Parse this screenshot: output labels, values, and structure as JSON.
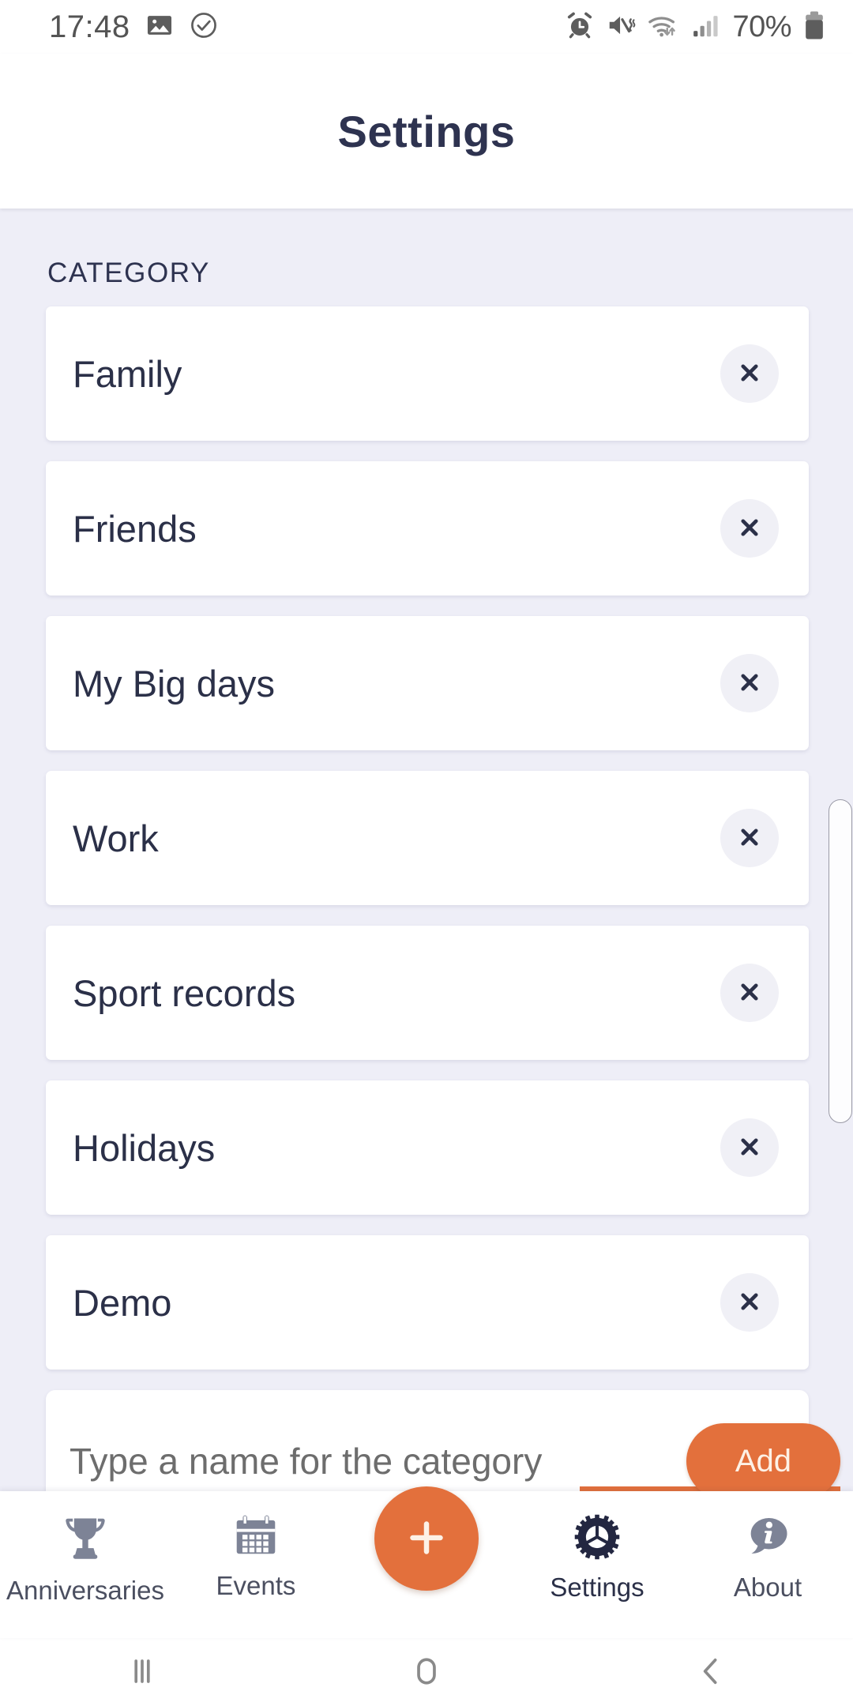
{
  "status_bar": {
    "time": "17:48",
    "battery_text": "70%",
    "icons": [
      "gallery-icon",
      "check-circle-icon",
      "alarm-icon",
      "mute-vibrate-icon",
      "wifi-icon",
      "signal-icon",
      "battery-icon"
    ]
  },
  "header": {
    "title": "Settings"
  },
  "main": {
    "section_label": "CATEGORY",
    "categories": [
      {
        "name": "Family"
      },
      {
        "name": "Friends"
      },
      {
        "name": "My Big days"
      },
      {
        "name": "Work"
      },
      {
        "name": "Sport records"
      },
      {
        "name": "Holidays"
      },
      {
        "name": "Demo"
      }
    ],
    "new_category": {
      "value": "",
      "placeholder": "Type a name for the category",
      "add_label": "Add"
    }
  },
  "bottom_nav": {
    "items": [
      {
        "label": "Anniversaries",
        "icon": "trophy-icon",
        "active": false
      },
      {
        "label": "Events",
        "icon": "calendar-icon",
        "active": false
      },
      {
        "label": "Settings",
        "icon": "gear-icon",
        "active": true
      },
      {
        "label": "About",
        "icon": "info-bubble-icon",
        "active": false
      }
    ],
    "fab": {
      "icon": "plus-icon"
    }
  },
  "android_nav": {
    "recents": "recents-icon",
    "home": "home-icon",
    "back": "back-icon"
  },
  "colors": {
    "accent": "#e3703c",
    "text_dark": "#2b3048",
    "background": "#eeeef7",
    "card": "#ffffff",
    "nav_inactive": "#7d8396"
  }
}
